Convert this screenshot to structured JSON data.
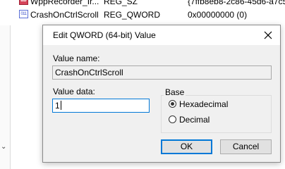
{
  "background_list": {
    "rows": [
      {
        "icon": "string-value-icon",
        "icon_text": "ab",
        "name": "WppRecorder_Ir...",
        "type": "REG_SZ",
        "data": "{7ffb8eb8-2c86-45d6-a7c5"
      },
      {
        "icon": "binary-value-icon",
        "icon_text": "011",
        "name": "CrashOnCtrlScroll",
        "type": "REG_QWORD",
        "data": "0x00000000 (0)"
      }
    ],
    "left_chevron": "⌄"
  },
  "dialog": {
    "title": "Edit QWORD (64-bit) Value",
    "value_name_label": "Value name:",
    "value_name": "CrashOnCtrlScroll",
    "value_data_label": "Value data:",
    "value_data": "1",
    "base_label": "Base",
    "base_options": [
      {
        "label": "Hexadecimal",
        "selected": true
      },
      {
        "label": "Decimal",
        "selected": false
      }
    ],
    "ok_label": "OK",
    "cancel_label": "Cancel"
  }
}
